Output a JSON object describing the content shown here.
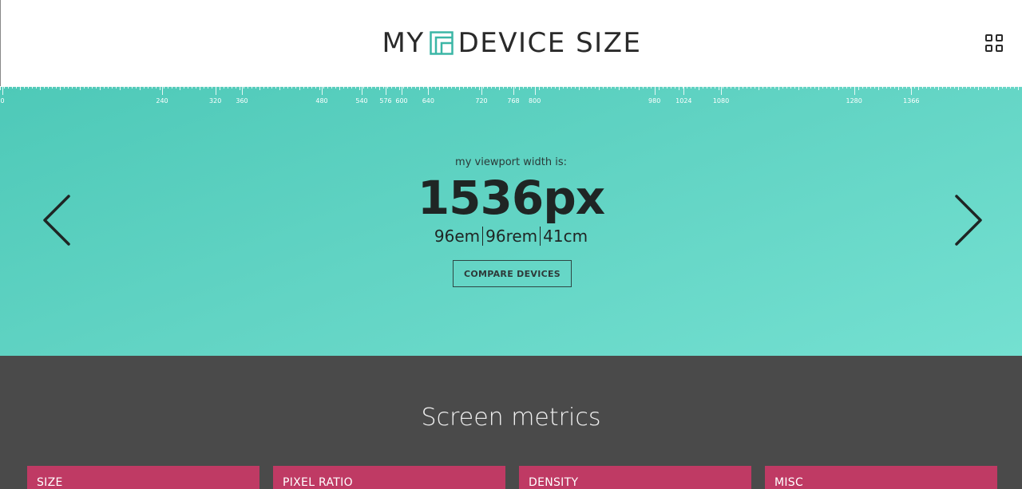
{
  "header": {
    "logo_left": "MY",
    "logo_right": "DEVICE SIZE",
    "menu_icon": "grid-icon"
  },
  "ruler": {
    "labels": [
      "0",
      "240",
      "320",
      "360",
      "480",
      "540",
      "576",
      "600",
      "640",
      "720",
      "768",
      "800",
      "980",
      "1024",
      "1080",
      "1280",
      "1366"
    ]
  },
  "hero": {
    "caption": "my viewport width is:",
    "value": "1536px",
    "units": [
      "96em",
      "96rem",
      "41cm"
    ],
    "compare_label": "COMPARE DEVICES",
    "prev_icon": "chevron-left-icon",
    "next_icon": "chevron-right-icon"
  },
  "metrics": {
    "title": "Screen metrics",
    "cards": [
      "SIZE",
      "PIXEL RATIO",
      "DENSITY",
      "MISC"
    ]
  },
  "colors": {
    "accent": "#bf3a64",
    "hero_start": "#4ec9b8",
    "hero_end": "#74e0d1",
    "dark_section": "#4a4a4a"
  }
}
